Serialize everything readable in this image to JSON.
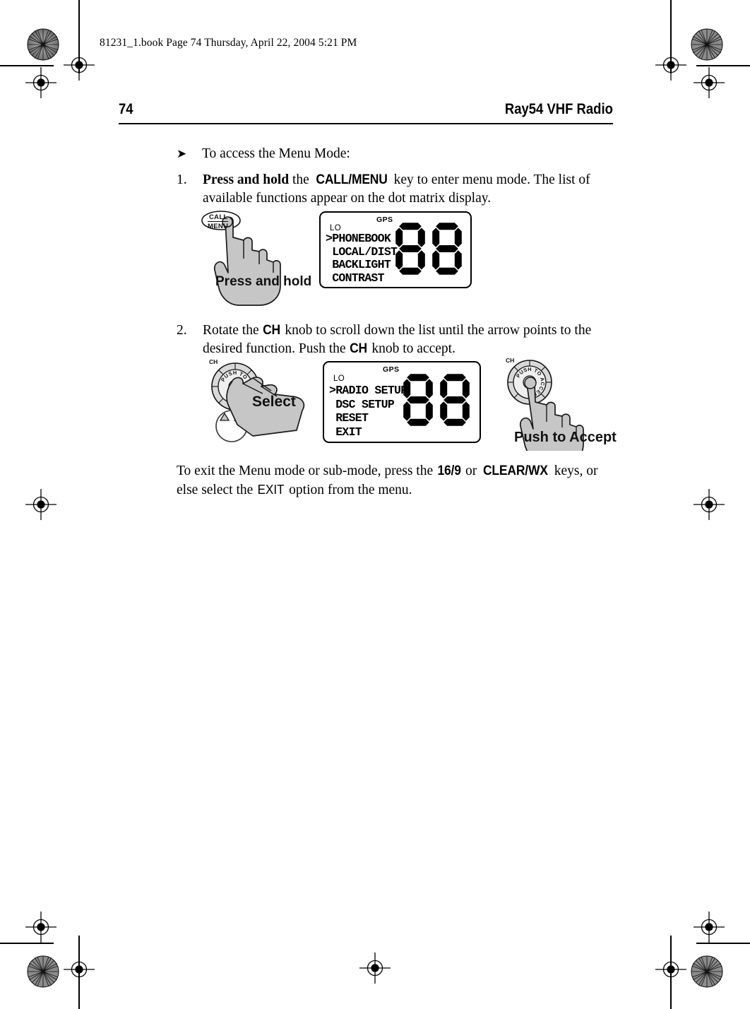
{
  "print_marks": {
    "filestamp": "81231_1.book  Page 74  Thursday, April 22, 2004  5:21 PM"
  },
  "running_head": {
    "page_number": "74",
    "book_title": "Ray54 VHF Radio"
  },
  "content": {
    "intro_arrow": "➤",
    "intro_text": "To access the Menu Mode:",
    "steps": [
      {
        "number": "1.",
        "parts": [
          {
            "text": "Press and hold",
            "style": "serif-bold"
          },
          {
            "text": " the ",
            "style": "plain"
          },
          {
            "text": "CALL/MENU",
            "style": "sans-bold"
          },
          {
            "text": " key to enter menu mode. The list of available functions appear on the dot matrix display.",
            "style": "plain"
          }
        ]
      },
      {
        "number": "2.",
        "parts": [
          {
            "text": "Rotate the ",
            "style": "plain"
          },
          {
            "text": "CH",
            "style": "sans-bold"
          },
          {
            "text": " knob to scroll down the list until the arrow points to the desired function. Push the ",
            "style": "plain"
          },
          {
            "text": "CH",
            "style": "sans-bold"
          },
          {
            "text": " knob to accept.",
            "style": "plain"
          }
        ]
      }
    ],
    "closing_parts": [
      {
        "text": "To exit the Menu mode or sub-mode, press the ",
        "style": "plain"
      },
      {
        "text": "16/9",
        "style": "sans-bold"
      },
      {
        "text": " or ",
        "style": "plain"
      },
      {
        "text": "CLEAR/WX",
        "style": "sans-bold"
      },
      {
        "text": " keys, or else select the ",
        "style": "plain"
      },
      {
        "text": "EXIT",
        "style": "sans-plain"
      },
      {
        "text": " option from the menu.",
        "style": "plain"
      }
    ]
  },
  "figures": {
    "figure1": {
      "button_label_line1": "CALL",
      "button_label_line2": "MENU",
      "caption": "Press and hold",
      "lcd": {
        "gps_indicator": "GPS",
        "lo_indicator": "LO",
        "cursor": ">",
        "items": [
          "PHONEBOOK",
          "LOCAL/DIST",
          "BACKLIGHT",
          "CONTRAST"
        ],
        "selected_index": 0,
        "channel_digits": "88"
      }
    },
    "figure2": {
      "knob_label": "CH",
      "knob_ring_text": "PUSH TO ACCEPT",
      "caption": "Select",
      "lcd": {
        "gps_indicator": "GPS",
        "lo_indicator": "LO",
        "cursor": ">",
        "items": [
          "RADIO SETUP",
          "DSC SETUP",
          "RESET",
          "EXIT"
        ],
        "selected_index": 0,
        "channel_digits": "88"
      }
    },
    "figure3": {
      "knob_label": "CH",
      "knob_ring_text": "PUSH TO ACCEPT",
      "caption": "Push to Accept"
    }
  },
  "colors": {
    "ink": "#000000",
    "paper": "#ffffff",
    "hand_fill": "#c6c6c6",
    "hand_stroke": "#1a1a1a",
    "knob_fill": "#d9d9d9"
  }
}
